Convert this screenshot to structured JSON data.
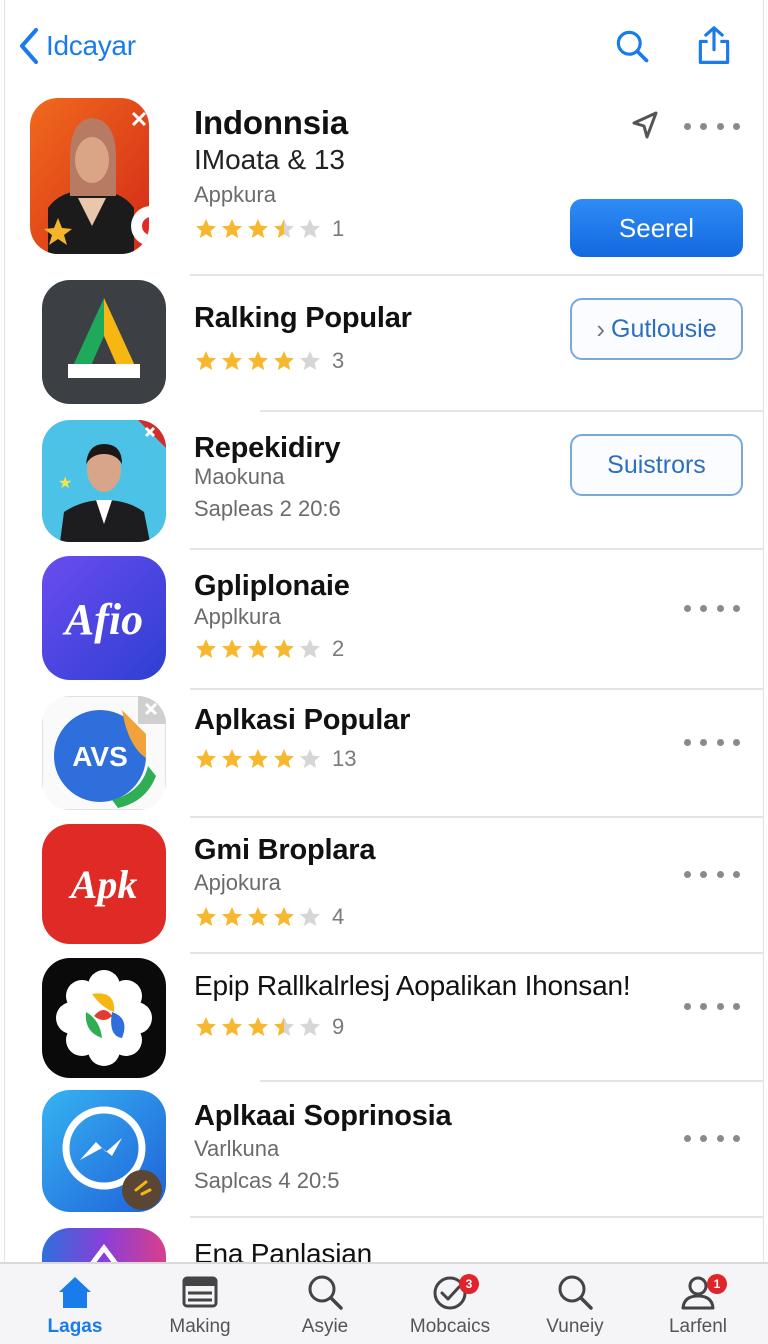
{
  "nav": {
    "back_label": "Idcayar"
  },
  "featured": {
    "title": "Indonnsia",
    "subtitle": "IMoata & 13",
    "category": "Appkura",
    "rating": 3.5,
    "rating_count": "1",
    "button_label": "Seerel"
  },
  "rows": [
    {
      "title": "Ralking Popular",
      "rating": 4,
      "rating_count": "3",
      "button_label": "Gutlousie",
      "button_icon": "chevron-right-icon"
    },
    {
      "title": "Repekidiry",
      "category": "Maokuna",
      "detail": "Sapleas 2 20:6",
      "button_label": "Suistrors"
    },
    {
      "title": "Gpliplonaie",
      "category": "Applkura",
      "rating": 4,
      "rating_count": "2",
      "icon_text": "Afio"
    },
    {
      "title": "Aplkasi Popular",
      "rating": 4,
      "rating_count": "13",
      "icon_text": "AVS"
    },
    {
      "title": "Gmi Broplara",
      "category": "Apjokura",
      "rating": 4,
      "rating_count": "4",
      "icon_text": "Apk"
    },
    {
      "title": "Epip Rallkalrlesj Aopalikan Ihonsan!",
      "rating": 3.5,
      "rating_count": "9"
    },
    {
      "title": "Aplkaai Soprinosia",
      "category": "Varlkuna",
      "detail": "Saplcas 4 20:5"
    },
    {
      "title": "Ena Panlasian"
    }
  ],
  "tabs": [
    {
      "label": "Lagas",
      "icon": "home-icon",
      "active": true
    },
    {
      "label": "Making",
      "icon": "list-icon"
    },
    {
      "label": "Asyie",
      "icon": "search-icon"
    },
    {
      "label": "Mobcaics",
      "icon": "check-icon",
      "badge": "3"
    },
    {
      "label": "Vuneiy",
      "icon": "search-icon"
    },
    {
      "label": "Larfenl",
      "icon": "person-icon",
      "badge": "1"
    }
  ],
  "colors": {
    "accent": "#1a7bea",
    "star": "#f5b82e",
    "badge": "#e0242c"
  }
}
